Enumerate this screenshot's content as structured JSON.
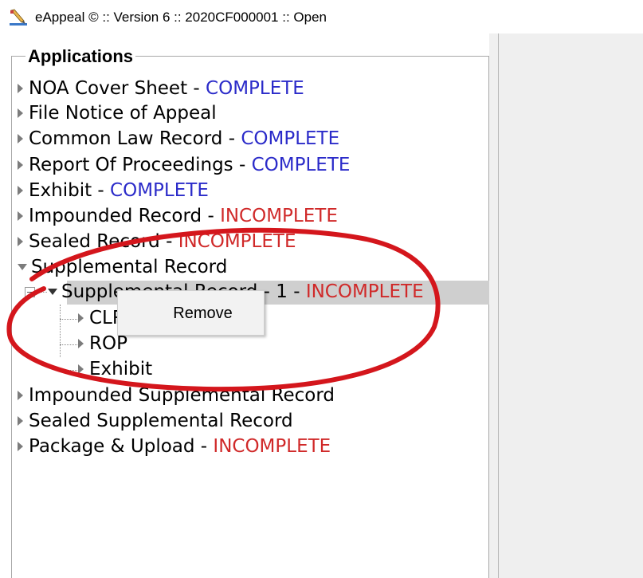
{
  "window": {
    "title": "eAppeal © :: Version 6 :: 2020CF000001 :: Open",
    "icon": "pencil-icon"
  },
  "applications": {
    "legend": "Applications",
    "items": [
      {
        "label": "NOA Cover Sheet - ",
        "status": "COMPLETE"
      },
      {
        "label": "File Notice of Appeal",
        "status": ""
      },
      {
        "label": "Common Law Record - ",
        "status": "COMPLETE"
      },
      {
        "label": "Report Of Proceedings - ",
        "status": "COMPLETE"
      },
      {
        "label": "Exhibit - ",
        "status": "COMPLETE"
      },
      {
        "label": "Impounded Record - ",
        "status": "INCOMPLETE"
      },
      {
        "label": "Sealed Record - ",
        "status": "INCOMPLETE"
      },
      {
        "label": "Supplemental Record",
        "status": ""
      }
    ],
    "supplemental_child": {
      "label": "Supplemental Record - 1 - ",
      "status": "INCOMPLETE"
    },
    "grandchildren": [
      {
        "label": "CLR"
      },
      {
        "label": "ROP"
      },
      {
        "label": "Exhibit"
      }
    ],
    "after_items": [
      {
        "label": "Impounded Supplemental Record",
        "status": ""
      },
      {
        "label": "Sealed Supplemental Record",
        "status": ""
      },
      {
        "label": "Package & Upload - ",
        "status": "INCOMPLETE"
      }
    ]
  },
  "context_menu": {
    "items": [
      {
        "label": "Remove"
      }
    ]
  },
  "colors": {
    "complete": "#2b2bc9",
    "incomplete": "#d02929",
    "annotation": "#d4161c"
  }
}
